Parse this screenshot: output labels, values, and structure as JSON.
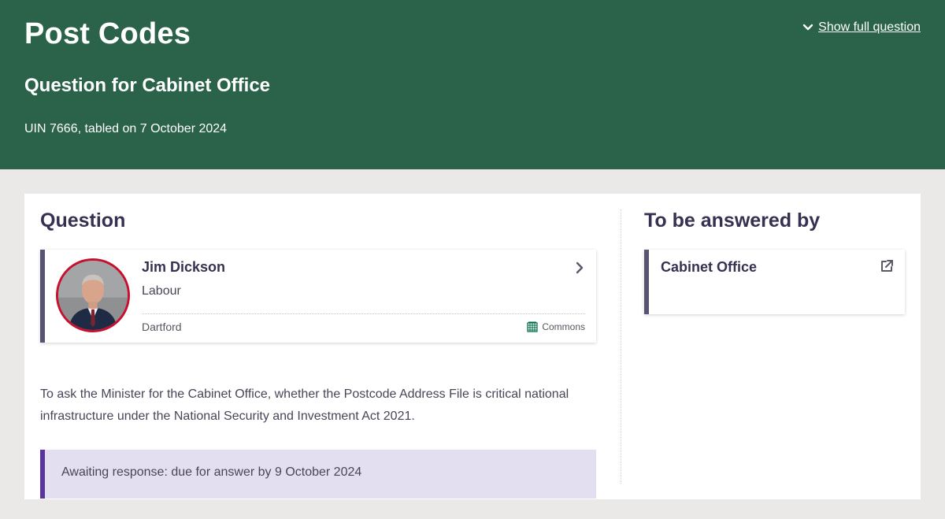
{
  "header": {
    "title": "Post Codes",
    "subtitle": "Question for Cabinet Office",
    "meta": "UIN 7666, tabled on 7 October 2024",
    "show_full_label": "Show full question"
  },
  "question_section": {
    "heading": "Question",
    "member": {
      "name": "Jim Dickson",
      "party": "Labour",
      "constituency": "Dartford",
      "house": "Commons",
      "party_color": "#c8102e"
    },
    "text": "To ask the Minister for the Cabinet Office, whether the Postcode Address File is critical national infrastructure under the National Security and Investment Act 2021.",
    "status": "Awaiting response: due for answer by 9 October 2024"
  },
  "answered_by": {
    "heading": "To be answered by",
    "department": "Cabinet Office"
  },
  "colors": {
    "header_green": "#2a634a",
    "page_bg": "#ebe9e7",
    "accent_purple": "#5a35a0",
    "status_bg": "#e4dff0",
    "commons_green": "#006e46"
  },
  "icons": {
    "show_full": "chevron-down-icon",
    "member_link": "chevron-right-icon",
    "house": "portcullis-icon",
    "dept_link": "external-link-icon"
  }
}
